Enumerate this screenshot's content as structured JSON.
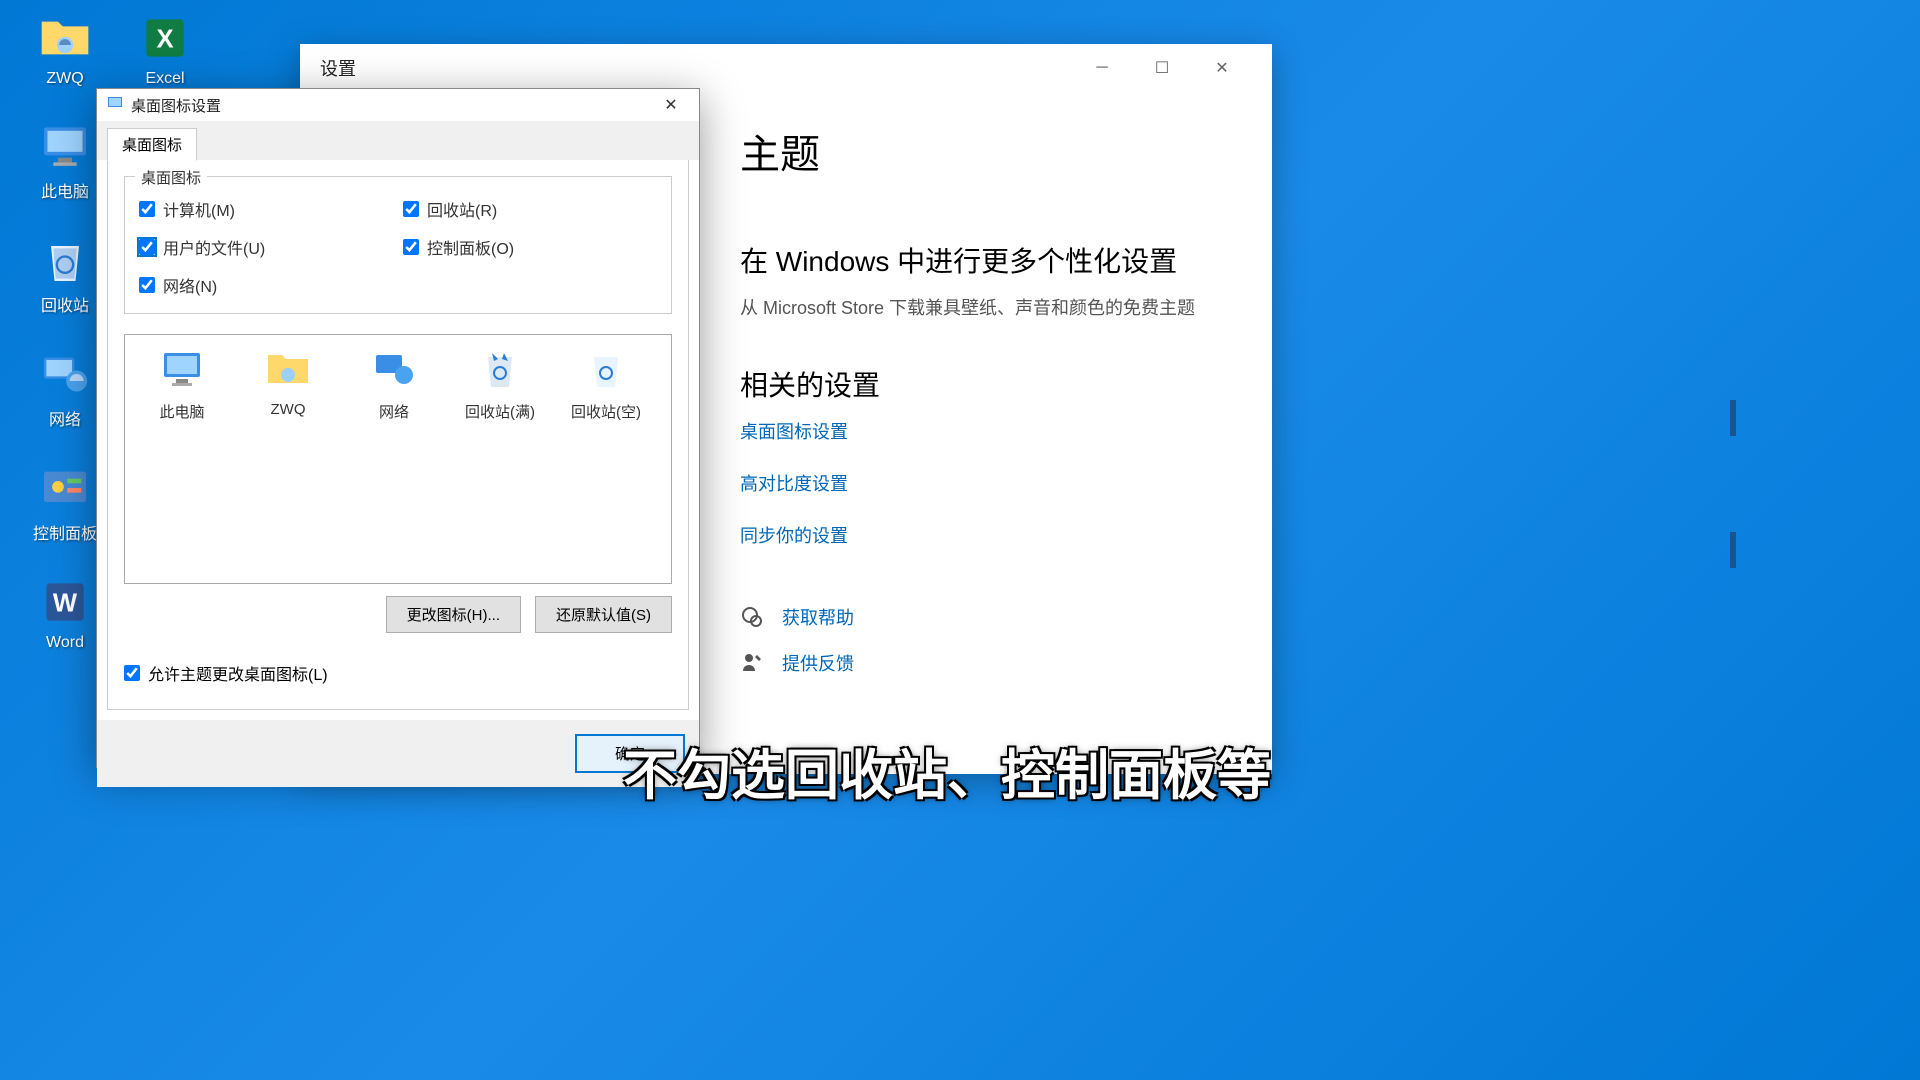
{
  "desktop": {
    "icons": [
      "ZWQ",
      "此电脑",
      "回收站",
      "网络",
      "控制面板",
      "Word"
    ],
    "excel": "Excel"
  },
  "settings": {
    "window_title": "设置",
    "heading": "主题",
    "more_heading": "在 Windows 中进行更多个性化设置",
    "more_text": "从 Microsoft Store 下载兼具壁纸、声音和颜色的免费主题",
    "related_heading": "相关的设置",
    "links": [
      "桌面图标设置",
      "高对比度设置",
      "同步你的设置"
    ],
    "help": "获取帮助",
    "feedback": "提供反馈"
  },
  "dialog": {
    "title": "桌面图标设置",
    "tab": "桌面图标",
    "group_title": "桌面图标",
    "checks": {
      "computer": "计算机(M)",
      "recycle": "回收站(R)",
      "user": "用户的文件(U)",
      "panel": "控制面板(O)",
      "network": "网络(N)"
    },
    "preview": [
      "此电脑",
      "ZWQ",
      "网络",
      "回收站(满)",
      "回收站(空)"
    ],
    "change_icon": "更改图标(H)...",
    "restore_default": "还原默认值(S)",
    "allow_theme": "允许主题更改桌面图标(L)",
    "ok": "确定"
  },
  "caption": "不勾选回收站、控制面板等"
}
